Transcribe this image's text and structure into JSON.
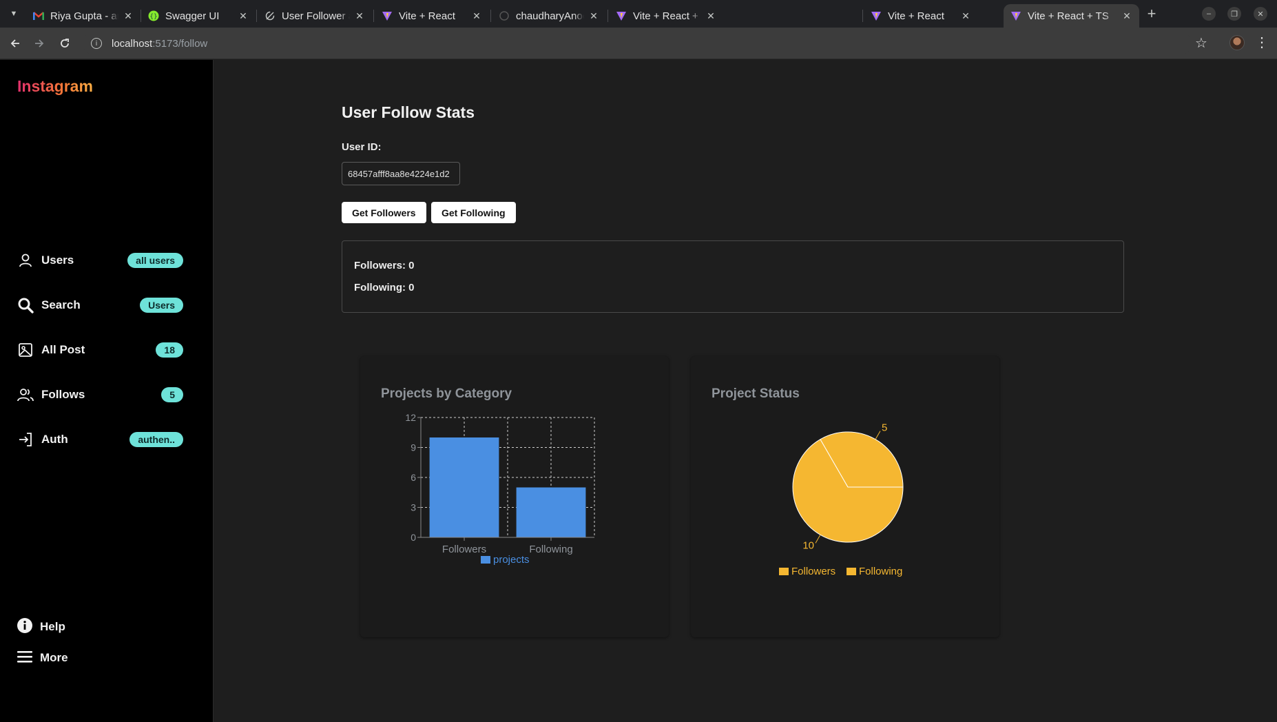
{
  "browser": {
    "tabs": [
      {
        "title": "Riya Gupta - anoop.",
        "favicon": "gmail-icon"
      },
      {
        "title": "Swagger UI",
        "favicon": "swagger-icon"
      },
      {
        "title": "User Follower and F",
        "favicon": "refresh-icon"
      },
      {
        "title": "Vite + React",
        "favicon": "vite-icon"
      },
      {
        "title": "chaudharyAnoop/sc",
        "favicon": "github-icon"
      },
      {
        "title": "Vite + React + TS",
        "favicon": "vite-icon"
      },
      {
        "title": "Vite + React",
        "favicon": "vite-icon"
      },
      {
        "title": "Vite + React + TS",
        "favicon": "vite-icon",
        "active": true
      }
    ],
    "url_host": "localhost",
    "url_path": ":5173/follow"
  },
  "sidebar": {
    "logo": "Instagram",
    "items": [
      {
        "label": "Users",
        "badge": "all users",
        "icon": "user-icon"
      },
      {
        "label": "Search",
        "badge": "Users",
        "icon": "search-icon"
      },
      {
        "label": "All Post",
        "badge": "18",
        "icon": "image-icon"
      },
      {
        "label": "Follows",
        "badge": "5",
        "icon": "users-icon"
      },
      {
        "label": "Auth",
        "badge": "authen..",
        "icon": "login-icon"
      }
    ],
    "bottom": [
      {
        "label": "Help",
        "icon": "info-icon"
      },
      {
        "label": "More",
        "icon": "menu-icon"
      }
    ]
  },
  "main": {
    "title": "User Follow Stats",
    "user_id_label": "User ID:",
    "user_id_value": "68457afff8aa8e4224e1d2",
    "get_followers_label": "Get Followers",
    "get_following_label": "Get Following",
    "followers_text": "Followers: 0",
    "following_text": "Following: 0"
  },
  "chart_data": [
    {
      "type": "bar",
      "title": "Projects by Category",
      "categories": [
        "Followers",
        "Following"
      ],
      "series": [
        {
          "name": "projects",
          "values": [
            10,
            5
          ]
        }
      ],
      "ylim": [
        0,
        12
      ],
      "yticks": [
        "0",
        "3",
        "6",
        "9",
        "12"
      ],
      "grid": true,
      "legend": "bottom",
      "color": "#4a8fe2"
    },
    {
      "type": "pie",
      "title": "Project Status",
      "labels": [
        "Followers",
        "Following"
      ],
      "values": [
        10,
        5
      ],
      "data_labels": [
        "10",
        "5"
      ],
      "legend": "bottom",
      "colors": [
        "#f5b731",
        "#f5b731"
      ]
    }
  ]
}
